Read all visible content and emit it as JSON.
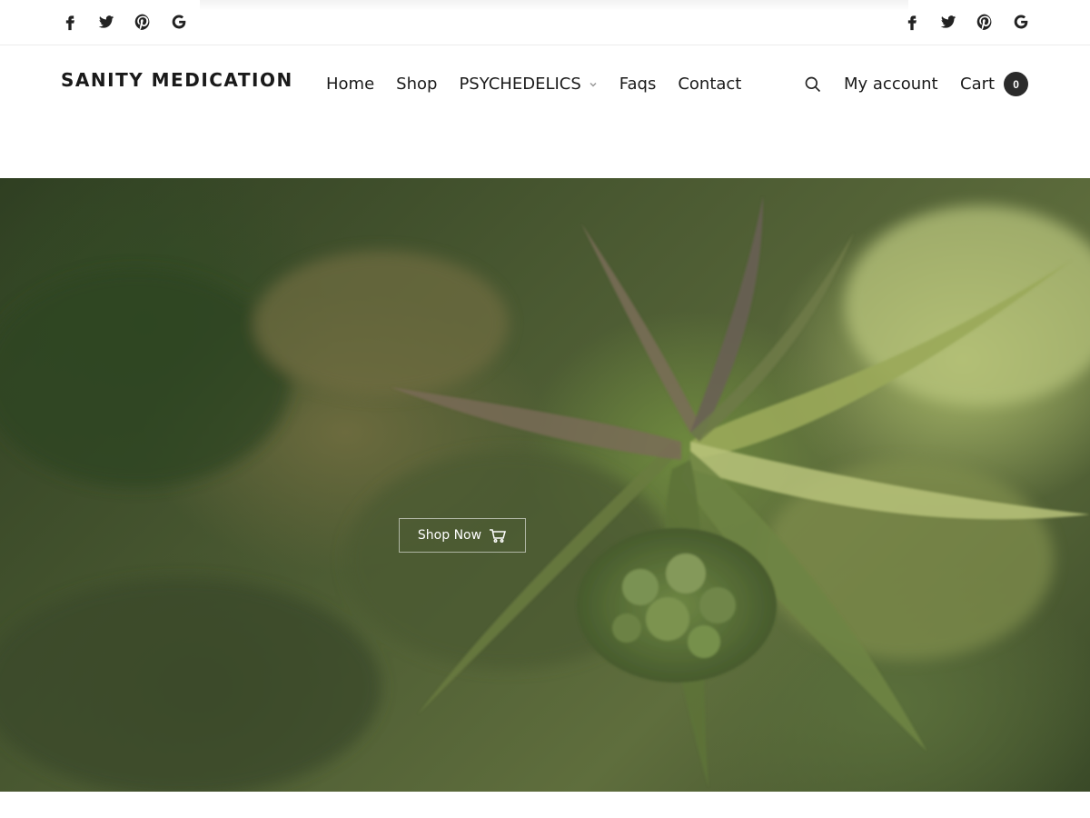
{
  "brand": {
    "name": "SANITY MEDICATION"
  },
  "social_icons": [
    "facebook-icon",
    "twitter-icon",
    "pinterest-icon",
    "google-icon"
  ],
  "nav": {
    "home": "Home",
    "shop": "Shop",
    "psychedelics": "PSYCHEDELICS",
    "faqs": "Faqs",
    "contact": "Contact"
  },
  "header_actions": {
    "search_icon": "search-icon",
    "account": "My account",
    "cart_label": "Cart",
    "cart_count": "0"
  },
  "hero": {
    "button_label": "Shop Now",
    "button_icon": "cart-icon"
  },
  "colors": {
    "text": "#1a1a1a",
    "badge_bg": "#2b2b2b",
    "hero_green": "#5f6e3d"
  }
}
